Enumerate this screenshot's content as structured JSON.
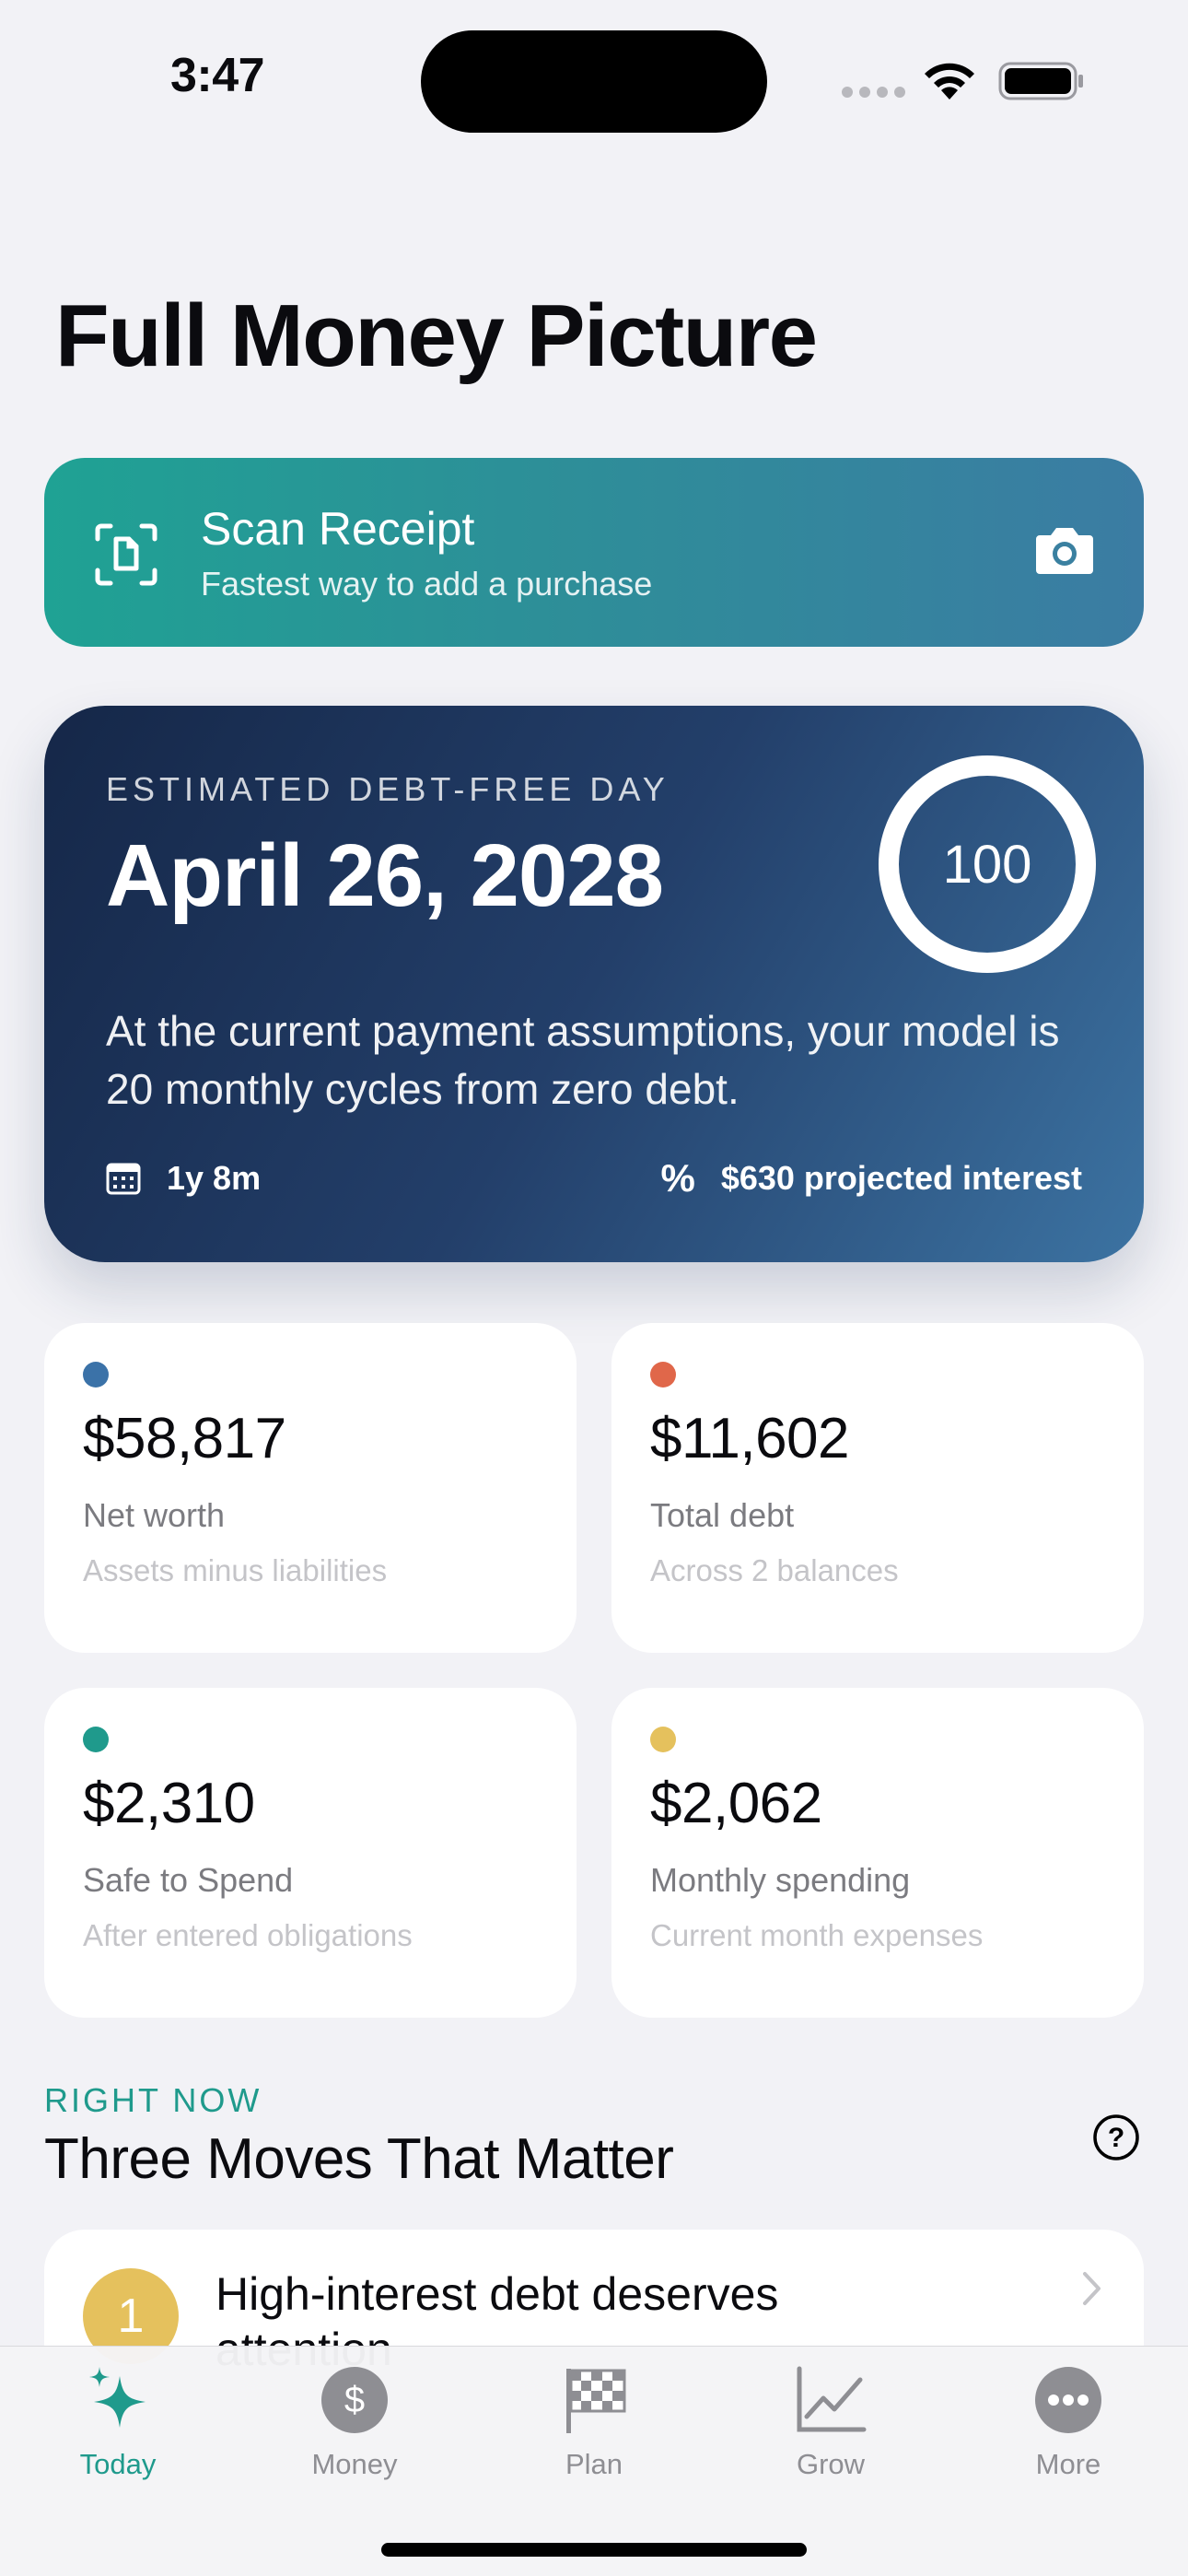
{
  "status_bar": {
    "time": "3:47"
  },
  "page": {
    "title": "Full Money Picture"
  },
  "scan_receipt": {
    "title": "Scan Receipt",
    "subtitle": "Fastest way to add a purchase",
    "icon": "document-scan-icon",
    "action_icon": "camera-icon"
  },
  "debt_free": {
    "kicker": "ESTIMATED DEBT-FREE DAY",
    "date": "April 26, 2028",
    "score": "100",
    "score_fill": 1.0,
    "description": "At the current payment assumptions, your model is 20 monthly cycles from zero debt.",
    "duration": "1y 8m",
    "duration_icon": "calendar-icon",
    "interest_symbol": "%",
    "interest": "$630 projected interest",
    "colors": {
      "start": "#152748",
      "end": "#3c73a2"
    }
  },
  "metrics": [
    {
      "value": "$58,817",
      "label": "Net worth",
      "sub": "Assets minus liabilities",
      "color": "#3b72a8"
    },
    {
      "value": "$11,602",
      "label": "Total debt",
      "sub": "Across 2 balances",
      "color": "#e0674a"
    },
    {
      "value": "$2,310",
      "label": "Safe to Spend",
      "sub": "After entered obligations",
      "color": "#1f9a8c"
    },
    {
      "value": "$2,062",
      "label": "Monthly spending",
      "sub": "Current month expenses",
      "color": "#e5c15d"
    }
  ],
  "right_now": {
    "kicker": "RIGHT NOW",
    "title": "Three Moves That Matter",
    "moves": [
      {
        "number": "1",
        "title": "High-interest debt deserves attention"
      }
    ]
  },
  "tabs": [
    {
      "label": "Today",
      "icon": "sparkles-icon",
      "active": true
    },
    {
      "label": "Money",
      "icon": "dollar-circle-icon",
      "active": false
    },
    {
      "label": "Plan",
      "icon": "checkered-flag-icon",
      "active": false
    },
    {
      "label": "Grow",
      "icon": "chart-line-icon",
      "active": false
    },
    {
      "label": "More",
      "icon": "ellipsis-circle-icon",
      "active": false
    }
  ],
  "accent_color": "#1f9a8c"
}
